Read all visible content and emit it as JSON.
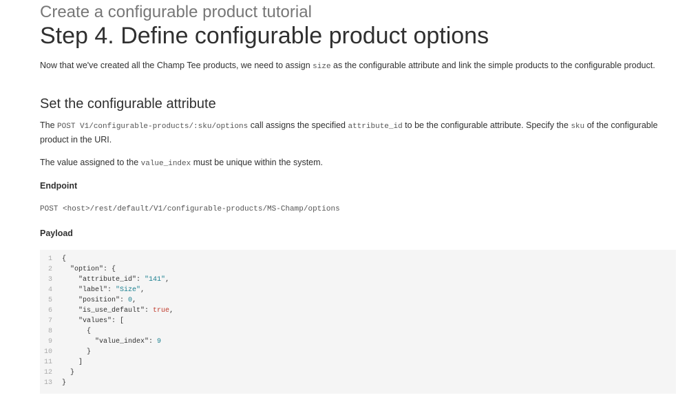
{
  "page": {
    "supertitle": "Create a configurable product tutorial",
    "title": "Step 4. Define configurable product options",
    "intro": {
      "before": "Now that we've created all the Champ Tee products, we need to assign ",
      "code": "size",
      "after": " as the configurable attribute and link the simple products to the configurable product."
    }
  },
  "section": {
    "heading": "Set the configurable attribute",
    "para1": {
      "t1": "The ",
      "c1": "POST V1/configurable-products/:sku/options",
      "t2": " call assigns the specified ",
      "c2": "attribute_id",
      "t3": " to be the configurable attribute. Specify the ",
      "c3": "sku",
      "t4": " of the configurable product in the URI."
    },
    "para2": {
      "t1": "The value assigned to the ",
      "c1": "value_index",
      "t2": " must be unique within the system."
    },
    "endpoint_label": "Endpoint",
    "endpoint": "POST <host>/rest/default/V1/configurable-products/MS-Champ/options",
    "payload_label": "Payload"
  },
  "code": {
    "lines": [
      {
        "num": "1",
        "text": "{"
      },
      {
        "num": "2",
        "text": "  \"option\": {"
      },
      {
        "num": "3",
        "text": "    \"attribute_id\": \"141\","
      },
      {
        "num": "4",
        "text": "    \"label\": \"Size\","
      },
      {
        "num": "5",
        "text": "    \"position\": 0,"
      },
      {
        "num": "6",
        "text": "    \"is_use_default\": true,"
      },
      {
        "num": "7",
        "text": "    \"values\": ["
      },
      {
        "num": "8",
        "text": "      {"
      },
      {
        "num": "9",
        "text": "        \"value_index\": 9"
      },
      {
        "num": "10",
        "text": "      }"
      },
      {
        "num": "11",
        "text": "    ]"
      },
      {
        "num": "12",
        "text": "  }"
      },
      {
        "num": "13",
        "text": "}"
      }
    ]
  }
}
